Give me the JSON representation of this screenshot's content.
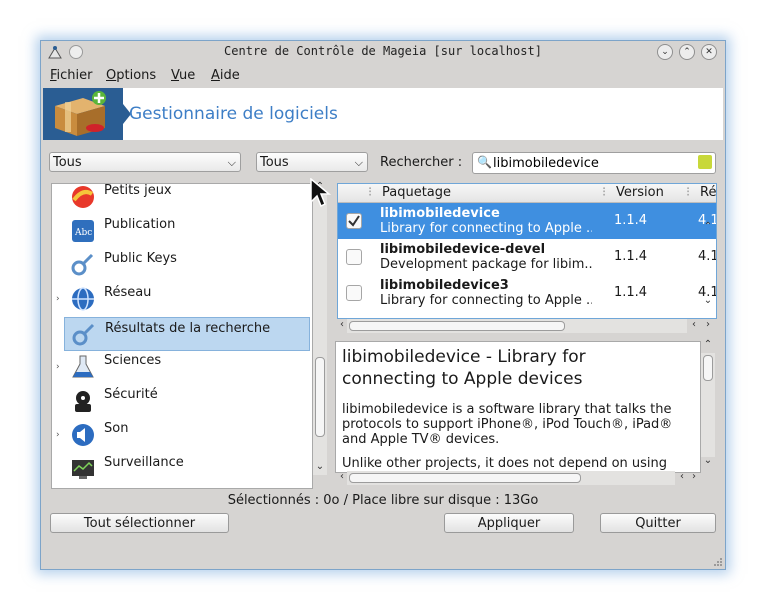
{
  "window": {
    "title": "Centre de Contrôle de Mageia  [sur localhost]"
  },
  "menu": [
    {
      "first": "F",
      "rest": "ichier"
    },
    {
      "first": "O",
      "rest": "ptions"
    },
    {
      "first": "V",
      "rest": "ue"
    },
    {
      "first": "A",
      "rest": "ide"
    }
  ],
  "banner": {
    "title": "Gestionnaire de logiciels"
  },
  "filters": {
    "type_value": "Tous",
    "status_value": "Tous",
    "search_label": "Rechercher :",
    "search_value": "libimobiledevice"
  },
  "categories": [
    {
      "label": "Petits jeux",
      "icon": "games-icon",
      "expandable": false
    },
    {
      "label": "Publication",
      "icon": "publishing-icon",
      "expandable": false
    },
    {
      "label": "Public Keys",
      "icon": "keys-icon",
      "expandable": false
    },
    {
      "label": "Réseau",
      "icon": "network-icon",
      "expandable": true
    },
    {
      "label": "Résultats de la recherche",
      "icon": "search-results-icon",
      "expandable": false,
      "selected": true
    },
    {
      "label": "Sciences",
      "icon": "sciences-icon",
      "expandable": true
    },
    {
      "label": "Sécurité",
      "icon": "security-icon",
      "expandable": false
    },
    {
      "label": "Son",
      "icon": "sound-icon",
      "expandable": true
    },
    {
      "label": "Surveillance",
      "icon": "monitoring-icon",
      "expandable": false
    }
  ],
  "package_table": {
    "headers": {
      "package": "Paquetage",
      "version": "Version",
      "release": "Ré"
    },
    "rows": [
      {
        "name": "libimobiledevice",
        "summary": "Library for connecting to Apple ...",
        "version": "1.1.4",
        "release": "4.1",
        "checked": true,
        "selected": true
      },
      {
        "name": "libimobiledevice-devel",
        "summary": "Development package for libim...",
        "version": "1.1.4",
        "release": "4.1",
        "checked": false,
        "selected": false
      },
      {
        "name": "libimobiledevice3",
        "summary": "Library for connecting to Apple ...",
        "version": "1.1.4",
        "release": "4.1",
        "checked": false,
        "selected": false
      }
    ]
  },
  "description": {
    "title": "libimobiledevice - Library for connecting to Apple devices",
    "paragraph1": "libimobiledevice is a software library that talks the protocols to support iPhone®, iPod Touch®, iPad® and Apple TV® devices.",
    "paragraph2": "Unlike other projects, it does not depend on using"
  },
  "status_text": "Sélectionnés : 0o / Place libre sur disque : 13Go",
  "buttons": {
    "select_all": "Tout sélectionner",
    "apply": "Appliquer",
    "quit": "Quitter"
  },
  "colors": {
    "selection": "#3f8fe0",
    "banner_text": "#3d7ec6",
    "window_glow": "#7da4c9"
  }
}
